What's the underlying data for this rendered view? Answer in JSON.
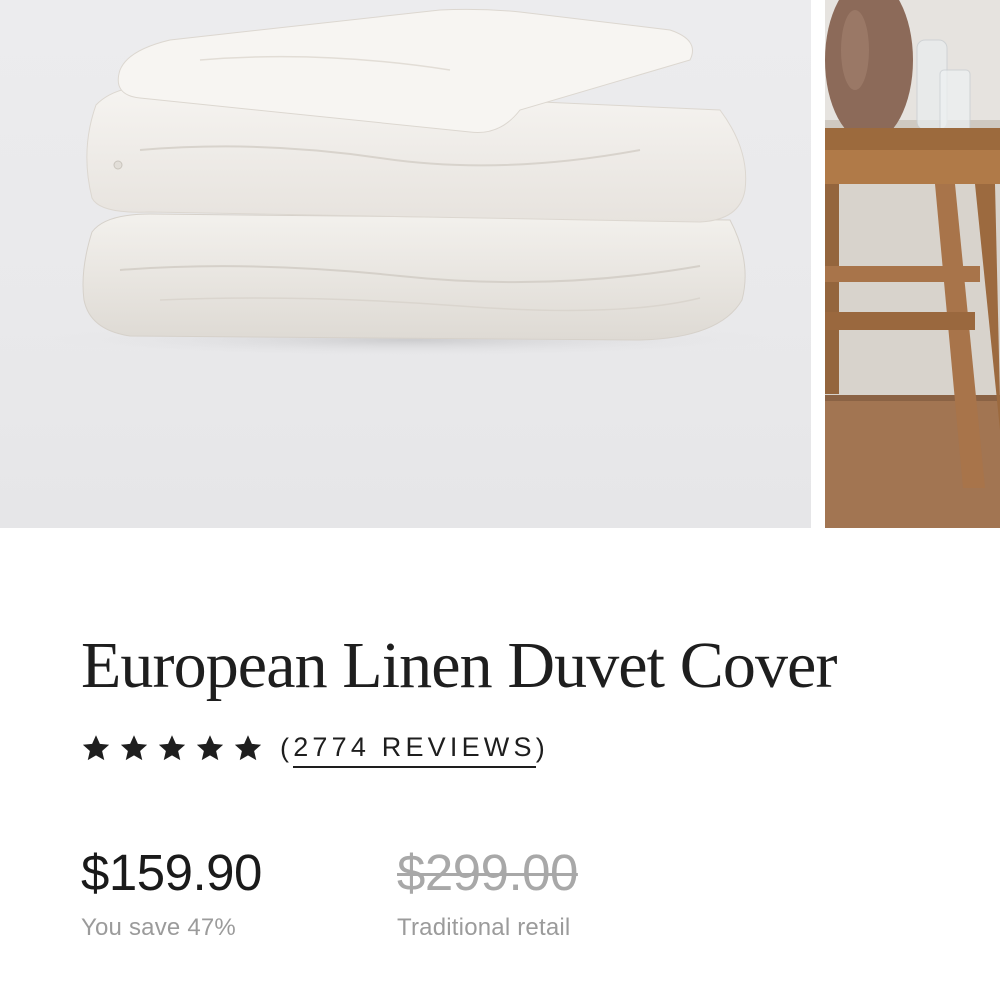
{
  "gallery": {
    "slides": [
      {
        "name": "folded-duvet-product-photo",
        "color": "#e9e9eb"
      },
      {
        "name": "bedroom-lifestyle-photo",
        "color": "#8a5a35"
      }
    ]
  },
  "product": {
    "title": "European Linen Duvet Cover",
    "rating": {
      "stars": 5,
      "star_icon": "star-icon",
      "open_paren": "(",
      "reviews_label": "2774 REVIEWS",
      "close_paren": ")"
    },
    "price": {
      "current": "$159.90",
      "savings": "You save 47%",
      "original": "$299.00",
      "original_label": "Traditional retail"
    }
  },
  "colors": {
    "text": "#1e1e1e",
    "muted": "#9b9b9b",
    "strike": "#a8a8a8",
    "image_bg": "#e9e9eb"
  }
}
